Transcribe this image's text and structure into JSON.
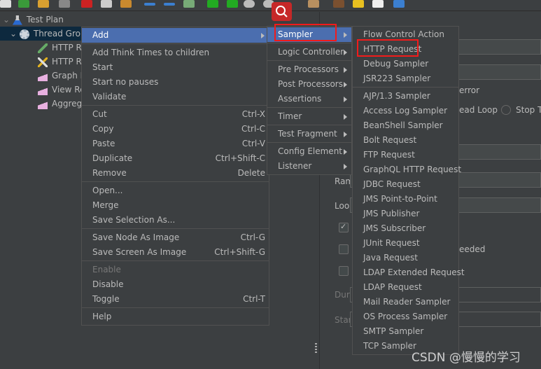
{
  "tree": {
    "items": [
      {
        "label": "Test Plan",
        "icon": "flask-icon"
      },
      {
        "label": "Thread Grou",
        "icon": "gear-icon"
      },
      {
        "label": "HTTP Re",
        "icon": "pipette-icon"
      },
      {
        "label": "HTTP Re",
        "icon": "wrench-icon"
      },
      {
        "label": "Graph R",
        "icon": "graph-icon"
      },
      {
        "label": "View Re",
        "icon": "graph-icon"
      },
      {
        "label": "Aggrega",
        "icon": "graph-icon"
      }
    ]
  },
  "panel": {
    "error_label": "error",
    "thread_loop": "ead Loop",
    "stop": "Stop Th",
    "ramp": "Ram",
    "loop": "Loop",
    "needed": "eeded",
    "duration": "Dura",
    "startup": "Start"
  },
  "context_menu": {
    "items": [
      {
        "label": "Add",
        "shortcut": "",
        "submenu": true
      },
      {
        "label": "Add Think Times to children"
      },
      {
        "label": "Start"
      },
      {
        "label": "Start no pauses"
      },
      {
        "label": "Validate"
      },
      {
        "label": "Cut",
        "shortcut": "Ctrl-X"
      },
      {
        "label": "Copy",
        "shortcut": "Ctrl-C"
      },
      {
        "label": "Paste",
        "shortcut": "Ctrl-V"
      },
      {
        "label": "Duplicate",
        "shortcut": "Ctrl+Shift-C"
      },
      {
        "label": "Remove",
        "shortcut": "Delete"
      },
      {
        "label": "Open..."
      },
      {
        "label": "Merge"
      },
      {
        "label": "Save Selection As..."
      },
      {
        "label": "Save Node As Image",
        "shortcut": "Ctrl-G"
      },
      {
        "label": "Save Screen As Image",
        "shortcut": "Ctrl+Shift-G"
      },
      {
        "label": "Enable",
        "disabled": true
      },
      {
        "label": "Disable"
      },
      {
        "label": "Toggle",
        "shortcut": "Ctrl-T"
      },
      {
        "label": "Help"
      }
    ]
  },
  "add_submenu": {
    "items": [
      "Sampler",
      "Logic Controller",
      "Pre Processors",
      "Post Processors",
      "Assertions",
      "Timer",
      "Test Fragment",
      "Config Element",
      "Listener"
    ]
  },
  "sampler_submenu": {
    "items": [
      "Flow Control Action",
      "HTTP Request",
      "Debug Sampler",
      "JSR223 Sampler",
      "AJP/1.3 Sampler",
      "Access Log Sampler",
      "BeanShell Sampler",
      "Bolt Request",
      "FTP Request",
      "GraphQL HTTP Request",
      "JDBC Request",
      "JMS Point-to-Point",
      "JMS Publisher",
      "JMS Subscriber",
      "JUnit Request",
      "Java Request",
      "LDAP Extended Request",
      "LDAP Request",
      "Mail Reader Sampler",
      "OS Process Sampler",
      "SMTP Sampler",
      "TCP Sampler"
    ]
  },
  "watermark": "CSDN @慢慢的学习",
  "colors": {
    "background": "#3c3f41",
    "selection": "#4b6eaf",
    "highlight_box": "#f21b1b"
  }
}
